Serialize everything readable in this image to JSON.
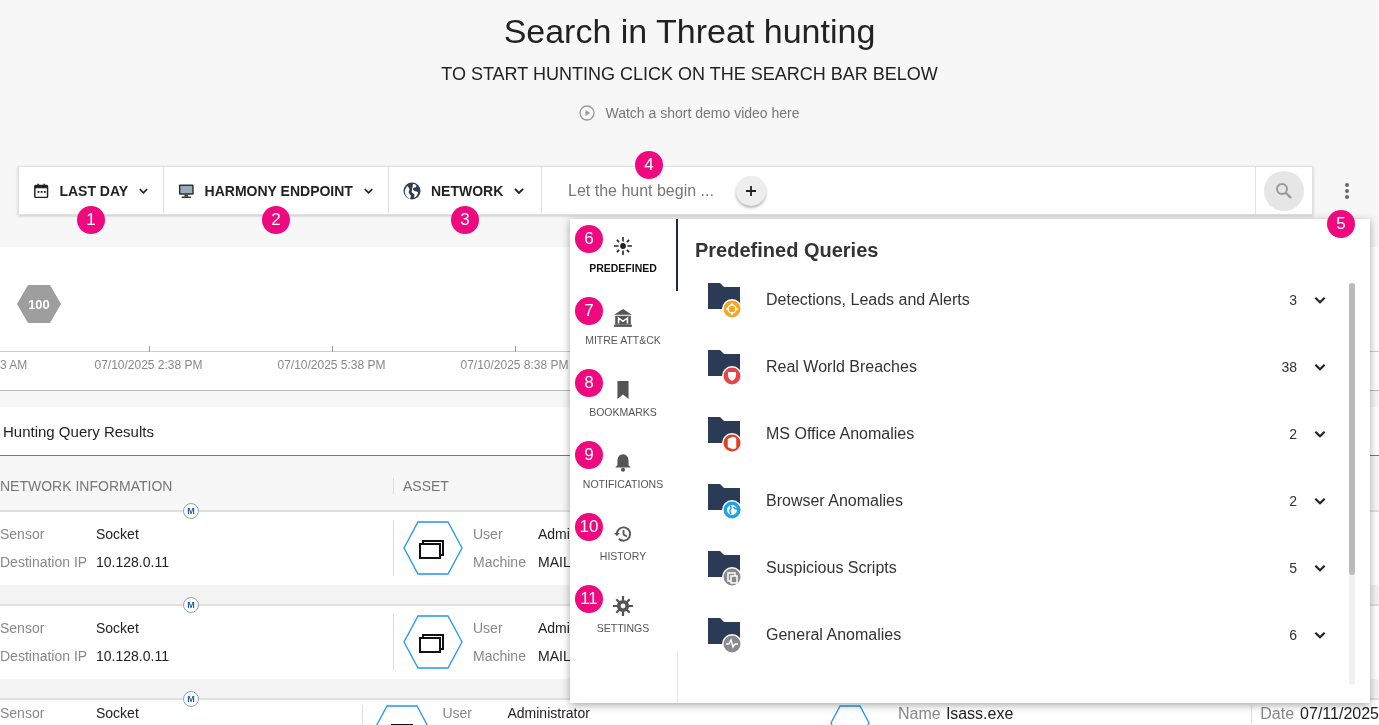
{
  "header": {
    "title": "Search in Threat hunting",
    "subtitle": "TO START HUNTING CLICK ON THE SEARCH BAR BELOW",
    "demo_link": "Watch a short demo video here"
  },
  "filters": [
    {
      "kind": "time",
      "label": "LAST DAY",
      "badge": "1"
    },
    {
      "kind": "endpoint",
      "label": "HARMONY ENDPOINT",
      "badge": "2"
    },
    {
      "kind": "network",
      "label": "NETWORK",
      "badge": "3"
    }
  ],
  "search": {
    "placeholder": "Let the hunt begin ...",
    "badge": "4"
  },
  "more_menu": {
    "badge": "5"
  },
  "timeline": {
    "bubble": "100",
    "ticks": [
      "3 AM",
      "07/10/2025 2:38 PM",
      "07/10/2025 5:38 PM",
      "07/10/2025 8:38 PM"
    ]
  },
  "results": {
    "title": "Hunting Query Results",
    "columns": [
      "NETWORK INFORMATION",
      "ASSET"
    ],
    "rows": [
      {
        "marker": "M",
        "network": [
          {
            "label": "Sensor",
            "value": "Socket"
          },
          {
            "label": "Destination IP",
            "value": "10.128.0.11"
          }
        ],
        "asset": [
          {
            "label": "User",
            "value": "Admi"
          },
          {
            "label": "Machine",
            "value": "MAIL"
          }
        ],
        "extra": []
      },
      {
        "marker": "M",
        "network": [
          {
            "label": "Sensor",
            "value": "Socket"
          },
          {
            "label": "Destination IP",
            "value": "10.128.0.11"
          }
        ],
        "asset": [
          {
            "label": "User",
            "value": "Admi"
          },
          {
            "label": "Machine",
            "value": "MAIL"
          }
        ],
        "extra": []
      },
      {
        "marker": "M",
        "network": [
          {
            "label": "Sensor",
            "value": "Socket"
          }
        ],
        "asset": [
          {
            "label": "User",
            "value": "Administrator"
          }
        ],
        "extra": [
          {
            "label": "Name",
            "value": "lsass.exe"
          },
          {
            "label": "Date",
            "value": "07/11/2025"
          }
        ]
      }
    ]
  },
  "panel": {
    "title": "Predefined Queries",
    "nav": [
      {
        "kind": "predefined",
        "label": "PREDEFINED",
        "selected": true,
        "badge": "6"
      },
      {
        "kind": "mitre",
        "label": "MITRE ATT&CK",
        "selected": false,
        "badge": "7"
      },
      {
        "kind": "bookmarks",
        "label": "BOOKMARKS",
        "selected": false,
        "badge": "8"
      },
      {
        "kind": "notifications",
        "label": "NOTIFICATIONS",
        "selected": false,
        "badge": "9"
      },
      {
        "kind": "history",
        "label": "HISTORY",
        "selected": false,
        "badge": "10"
      },
      {
        "kind": "settings",
        "label": "SETTINGS",
        "selected": false,
        "badge": "11"
      }
    ],
    "queries": [
      {
        "kind": "target",
        "name": "Detections, Leads and Alerts",
        "count": "3",
        "color": "#f5a623"
      },
      {
        "kind": "shield",
        "name": "Real World Breaches",
        "count": "38",
        "color": "#e8454a"
      },
      {
        "kind": "office",
        "name": "MS Office Anomalies",
        "count": "2",
        "color": "#e2401c"
      },
      {
        "kind": "globe",
        "name": "Browser Anomalies",
        "count": "2",
        "color": "#1aa3e8"
      },
      {
        "kind": "script",
        "name": "Suspicious Scripts",
        "count": "5",
        "color": "#8a8a8a"
      },
      {
        "kind": "pulse",
        "name": "General Anomalies",
        "count": "6",
        "color": "#8a8a8a"
      }
    ]
  }
}
